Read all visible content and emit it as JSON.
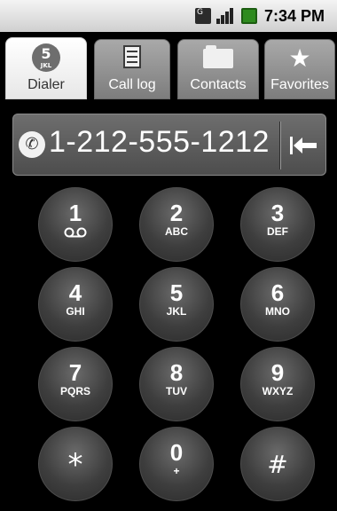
{
  "status_bar": {
    "data_indicator": "G",
    "time": "7:34 PM"
  },
  "tabs": [
    {
      "label": "Dialer",
      "active": true,
      "icon": "dialer-5-jkl-icon",
      "icon_number": "5",
      "icon_letters": "JKL"
    },
    {
      "label": "Call log",
      "active": false,
      "icon": "call-log-icon"
    },
    {
      "label": "Contacts",
      "active": false,
      "icon": "contacts-icon"
    },
    {
      "label": "Favorites",
      "active": false,
      "icon": "star-icon"
    }
  ],
  "digits": {
    "number": "1-212-555-1212",
    "icon": "handset-icon",
    "backspace_icon": "backspace-arrow-icon"
  },
  "keypad": [
    {
      "num": "1",
      "letters": "",
      "icon": "voicemail-icon"
    },
    {
      "num": "2",
      "letters": "ABC"
    },
    {
      "num": "3",
      "letters": "DEF"
    },
    {
      "num": "4",
      "letters": "GHI"
    },
    {
      "num": "5",
      "letters": "JKL"
    },
    {
      "num": "6",
      "letters": "MNO"
    },
    {
      "num": "7",
      "letters": "PQRS"
    },
    {
      "num": "8",
      "letters": "TUV"
    },
    {
      "num": "9",
      "letters": "WXYZ"
    },
    {
      "num": "*",
      "letters": ""
    },
    {
      "num": "0",
      "letters": "+"
    },
    {
      "num": "#",
      "letters": ""
    }
  ],
  "colors": {
    "background": "#000000",
    "key_fill": "#3e3e3e",
    "status_bar": "#dcdcdc",
    "battery": "#2e8b1e"
  }
}
